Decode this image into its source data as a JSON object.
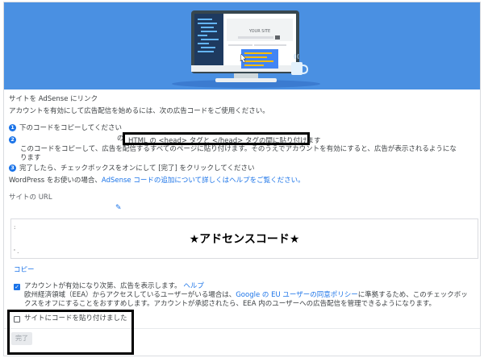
{
  "hero": {
    "site_label": "YOUR SITE"
  },
  "title": "サイトを AdSense にリンク",
  "intro": "アカウントを有効にして広告配信を始めるには、次の広告コードをご使用ください。",
  "steps": [
    {
      "num": "1",
      "text": "下のコードをコピーしてください"
    },
    {
      "num": "2",
      "highlight": "HTML の <head> タグと </head> タグの間に貼り付けます",
      "prefix": "の",
      "detail_1": "このコードをコピーして、広告を配信するすべてのページに貼り付けます。そのうえでアカウントを有効にすると、広告が表示されるようにな",
      "detail_2": "ります"
    },
    {
      "num": "3",
      "text": "完了したら、チェックボックスをオンにして [完了] をクリックしてください"
    }
  ],
  "wordpress": {
    "text": "WordPress をお使いの場合、",
    "link": "AdSense コードの追加について詳しくはヘルプをご覧ください。"
  },
  "site_url_label": "サイトの URL",
  "code_placeholder": "★アドセンスコード★",
  "copy_label": "コピー",
  "ads_option": {
    "checked": true,
    "label": "アカウントが有効になり次第、広告を表示します。",
    "help_link": "ヘルプ",
    "eea_text_1": "欧州経済領域（EEA）からアクセスしているユーザーがいる場合は、",
    "eea_link": "Google の EU ユーザーの同意ポリシー",
    "eea_text_2": "に準拠するため、このチェックボッ",
    "eea_text_3": "クスをオフにすることをおすすめします。アカウントが承認されたら、EEA 内のユーザーへの広告配信を管理できるようになります。"
  },
  "pasted_checkbox": {
    "checked": false,
    "label": "サイトにコードを貼り付けました"
  },
  "done_button": "完了",
  "colors": {
    "hero_bg": "#4a90e2",
    "link": "#1a73e8",
    "highlight_border": "#000000"
  }
}
